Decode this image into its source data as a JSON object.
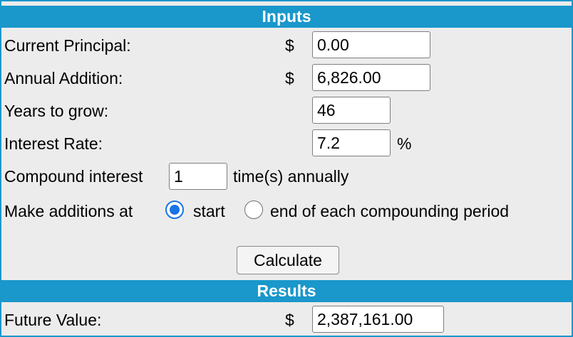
{
  "inputs": {
    "title": "Inputs",
    "current_principal": {
      "label": "Current Principal:",
      "currency": "$",
      "value": "0.00"
    },
    "annual_addition": {
      "label": "Annual Addition:",
      "currency": "$",
      "value": "6,826.00"
    },
    "years_to_grow": {
      "label": "Years to grow:",
      "value": "46"
    },
    "interest_rate": {
      "label": "Interest Rate:",
      "value": "7.2",
      "unit": "%"
    },
    "compound": {
      "label_before": "Compound interest",
      "value": "1",
      "label_after": "time(s) annually"
    },
    "additions": {
      "label": "Make additions at",
      "options": [
        {
          "label": "start",
          "selected": true
        },
        {
          "label": "end of each compounding period",
          "selected": false
        }
      ]
    }
  },
  "calculate_label": "Calculate",
  "results": {
    "title": "Results",
    "future_value": {
      "label": "Future Value:",
      "currency": "$",
      "value": "2,387,161.00"
    }
  },
  "colors": {
    "accent": "#1a97cb",
    "background": "#ececec",
    "radio_selected": "#1a73e8"
  }
}
